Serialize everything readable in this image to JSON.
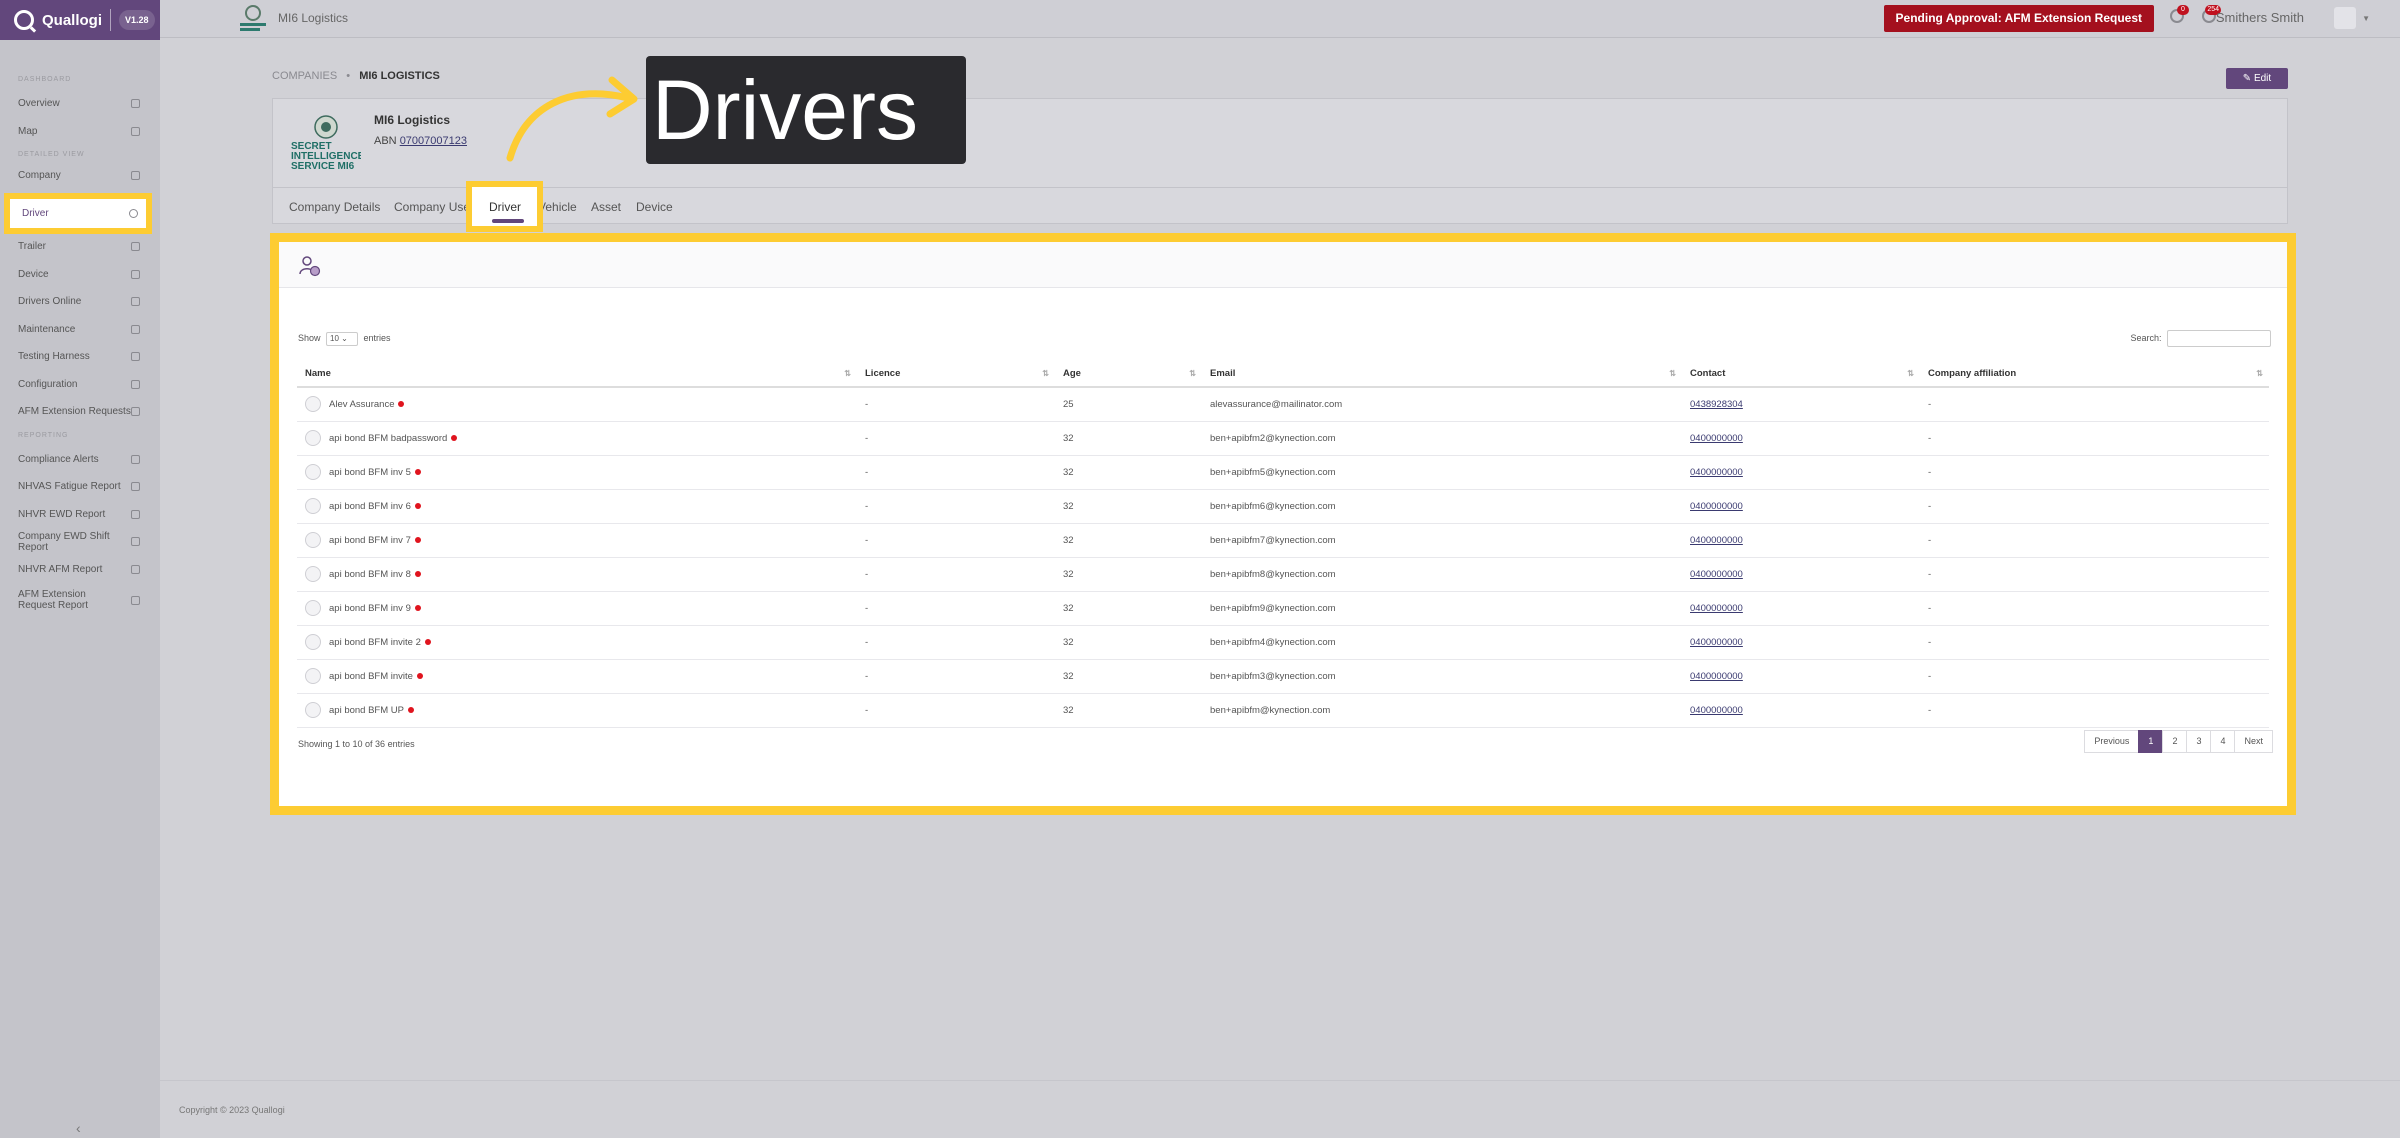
{
  "app": {
    "name": "Quallogi",
    "version": "V1.28"
  },
  "sidebar": {
    "sections": {
      "dashboard": "DASHBOARD",
      "detailed": "DETAILED VIEW",
      "reporting": "REPORTING"
    },
    "items": [
      {
        "label": "Overview",
        "icon": "grid-icon"
      },
      {
        "label": "Map",
        "icon": "map-icon"
      },
      {
        "label": "Company",
        "icon": "building-icon"
      },
      {
        "label": "Driver",
        "icon": "user-icon"
      },
      {
        "label": "Vehicle",
        "icon": "truck-icon"
      },
      {
        "label": "Trailer",
        "icon": "trailer-icon"
      },
      {
        "label": "Device",
        "icon": "phone-icon"
      },
      {
        "label": "Drivers Online",
        "icon": "wifi-icon"
      },
      {
        "label": "Maintenance",
        "icon": "wrench-icon"
      },
      {
        "label": "Testing Harness",
        "icon": "monitor-icon"
      },
      {
        "label": "Configuration",
        "icon": "sliders-icon"
      },
      {
        "label": "AFM Extension Requests",
        "icon": "sort-icon"
      }
    ],
    "reports": [
      {
        "label": "Compliance Alerts",
        "icon": "warning-icon"
      },
      {
        "label": "NHVAS Fatigue Report",
        "icon": "document-icon"
      },
      {
        "label": "NHVR EWD Report",
        "icon": "document-icon"
      },
      {
        "label": "Company EWD Shift Report",
        "icon": "document-icon"
      },
      {
        "label": "NHVR AFM Report",
        "icon": "document-icon"
      },
      {
        "label": "AFM Extension Request Report",
        "icon": "document-icon"
      }
    ],
    "collapse": "‹"
  },
  "header": {
    "company": "MI6 Logistics",
    "pending": "Pending Approval: AFM Extension Request",
    "badge1": "0",
    "badge2": "254",
    "user": "Smithers Smith"
  },
  "breadcrumb": {
    "root": "COMPANIES",
    "sep": "•",
    "current": "MI6 LOGISTICS"
  },
  "edit": "✎ Edit",
  "company": {
    "name": "MI6 Logistics",
    "abn_label": "ABN",
    "abn": "07007007123",
    "logo_text": [
      "SECRET",
      "INTELLIGENCE",
      "SERVICE MI6"
    ]
  },
  "tabs": [
    "Company Details",
    "Company User",
    "Driver",
    "Vehicle",
    "Asset",
    "Device"
  ],
  "callout": "Drivers",
  "table": {
    "show": "Show",
    "entries_value": "10",
    "entries": "entries",
    "search": "Search:",
    "columns": [
      "Name",
      "Licence",
      "Age",
      "Email",
      "Contact",
      "Company affiliation"
    ],
    "rows": [
      [
        "Alev Assurance",
        "-",
        "25",
        "alevassurance@mailinator.com",
        "0438928304",
        "-"
      ],
      [
        "api bond BFM badpassword",
        "-",
        "32",
        "ben+apibfm2@kynection.com",
        "0400000000",
        "-"
      ],
      [
        "api bond BFM inv 5",
        "-",
        "32",
        "ben+apibfm5@kynection.com",
        "0400000000",
        "-"
      ],
      [
        "api bond BFM inv 6",
        "-",
        "32",
        "ben+apibfm6@kynection.com",
        "0400000000",
        "-"
      ],
      [
        "api bond BFM inv 7",
        "-",
        "32",
        "ben+apibfm7@kynection.com",
        "0400000000",
        "-"
      ],
      [
        "api bond BFM inv 8",
        "-",
        "32",
        "ben+apibfm8@kynection.com",
        "0400000000",
        "-"
      ],
      [
        "api bond BFM inv 9",
        "-",
        "32",
        "ben+apibfm9@kynection.com",
        "0400000000",
        "-"
      ],
      [
        "api bond BFM invite 2",
        "-",
        "32",
        "ben+apibfm4@kynection.com",
        "0400000000",
        "-"
      ],
      [
        "api bond BFM invite",
        "-",
        "32",
        "ben+apibfm3@kynection.com",
        "0400000000",
        "-"
      ],
      [
        "api bond BFM UP",
        "-",
        "32",
        "ben+apibfm@kynection.com",
        "0400000000",
        "-"
      ]
    ],
    "showing": "Showing 1 to 10 of 36 entries",
    "pager": [
      "Previous",
      "1",
      "2",
      "3",
      "4",
      "Next"
    ]
  },
  "footer": "Copyright © 2023 Quallogi"
}
